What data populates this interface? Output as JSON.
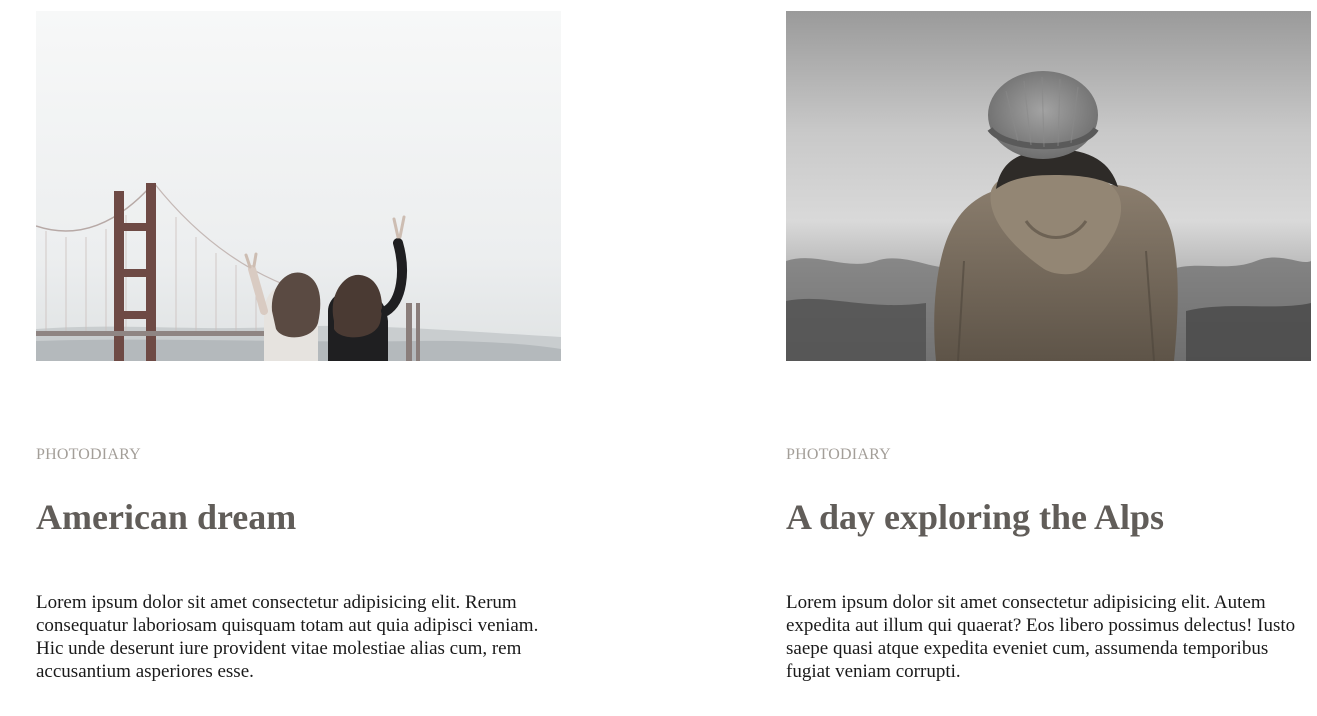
{
  "posts": [
    {
      "image_alt": "Two friends flashing peace signs in front of the Golden Gate Bridge",
      "category": "PHOTODIARY",
      "title": "American dream",
      "excerpt": "Lorem ipsum dolor sit amet consectetur adipisicing elit. Rerum consequatur laboriosam quisquam totam aut quia adipisci veniam. Hic unde deserunt iure provident vitae molestiae alias cum, rem accusantium asperiores esse."
    },
    {
      "image_alt": "Person in a knit beanie and hooded jacket looking over misty mountains",
      "category": "PHOTODIARY",
      "title": "A day exploring the Alps",
      "excerpt": "Lorem ipsum dolor sit amet consectetur adipisicing elit. Autem expedita aut illum qui quaerat? Eos libero possimus delectus! Iusto saepe quasi atque expedita eveniet cum, assumenda temporibus fugiat veniam corrupti."
    }
  ],
  "colors": {
    "category": "#a39e98",
    "title": "#615d59",
    "body_text": "#1a1a1a"
  }
}
